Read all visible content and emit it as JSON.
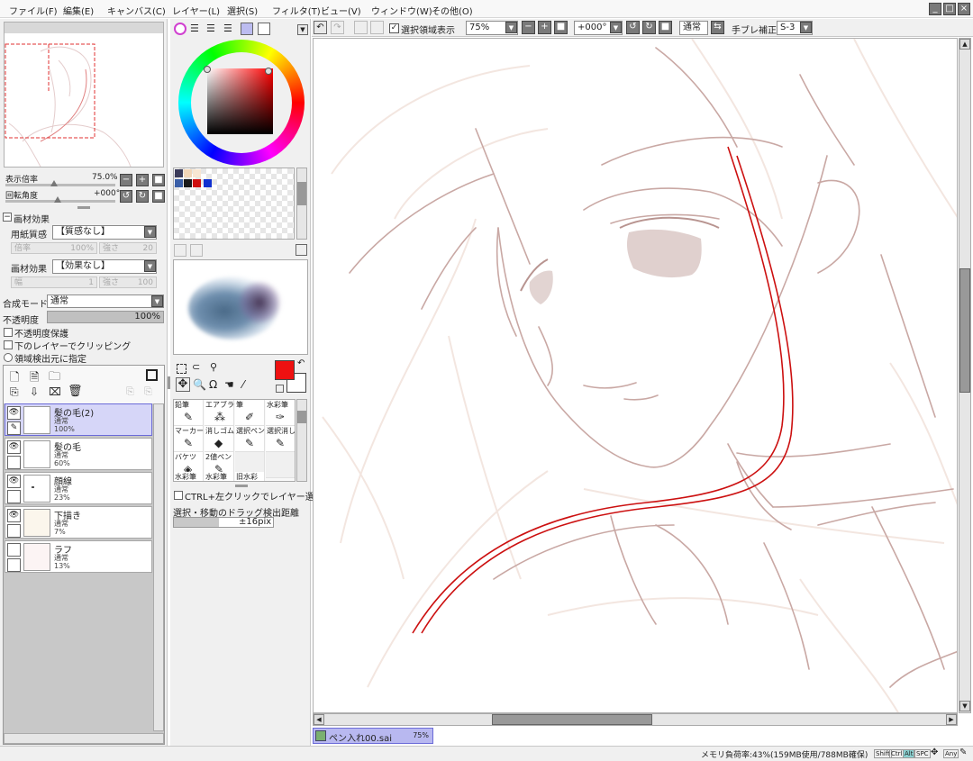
{
  "menu": [
    "ファイル(F)",
    "編集(E)",
    "キャンバス(C)",
    "レイヤー(L)",
    "選択(S)",
    "フィルタ(T)",
    "ビュー(V)",
    "ウィンドウ(W)",
    "その他(O)"
  ],
  "toolbar": {
    "show_selection_label": "選択領域表示",
    "zoom_value": "75%",
    "rotation_value": "+000°",
    "blend_mode": "通常",
    "stabilizer_label": "手ブレ補正",
    "stabilizer_value": "S-3"
  },
  "navigator": {
    "zoom_label": "表示倍率",
    "zoom_value": "75.0%",
    "rotation_label": "回転角度",
    "rotation_value": "+000°"
  },
  "effects": {
    "header": "画材効果",
    "paper_label": "用紙質感",
    "paper_value": "【質感なし】",
    "paper_sub_1": "倍率",
    "paper_sub_1_value": "100%",
    "paper_sub_2": "強さ",
    "paper_sub_2_value": "20",
    "effect_label": "画材効果",
    "effect_value": "【効果なし】",
    "effect_sub_1": "幅",
    "effect_sub_1_value": "1",
    "effect_sub_2": "強さ",
    "effect_sub_2_value": "100"
  },
  "layer_props": {
    "blend_label": "合成モード",
    "blend_value": "通常",
    "opacity_label": "不透明度",
    "opacity_value": "100%",
    "opacity_percent": 100,
    "lock_label": "不透明度保護",
    "clip_label": "下のレイヤーでクリッピング",
    "detect_label": "領域検出元に指定"
  },
  "layers": [
    {
      "name": "髪の毛(2)",
      "mode": "通常",
      "opacity": "100%",
      "selected": true
    },
    {
      "name": "髪の毛",
      "mode": "通常",
      "opacity": "60%",
      "selected": false
    },
    {
      "name": "顔線",
      "mode": "通常",
      "opacity": "23%",
      "selected": false
    },
    {
      "name": "下描き",
      "mode": "通常",
      "opacity": "7%",
      "selected": false
    },
    {
      "name": "ラフ",
      "mode": "通常",
      "opacity": "13%",
      "selected": false
    }
  ],
  "tools": [
    {
      "label": "鉛筆",
      "icon": "✎"
    },
    {
      "label": "エアブラシ",
      "icon": "⁂"
    },
    {
      "label": "筆",
      "icon": "✐"
    },
    {
      "label": "水彩筆",
      "icon": "✑"
    },
    {
      "label": "マーカー",
      "icon": "✎"
    },
    {
      "label": "消しゴム",
      "icon": "◆"
    },
    {
      "label": "選択ペン",
      "icon": "✎"
    },
    {
      "label": "選択消し",
      "icon": "✎"
    },
    {
      "label": "バケツ",
      "icon": "◈"
    },
    {
      "label": "2値ペン",
      "icon": "✎"
    },
    {
      "label": "",
      "icon": ""
    },
    {
      "label": "",
      "icon": ""
    },
    {
      "label": "水彩筆",
      "icon": ""
    },
    {
      "label": "水彩筆",
      "icon": ""
    },
    {
      "label": "旧水彩",
      "icon": ""
    },
    {
      "label": "",
      "icon": ""
    }
  ],
  "options": {
    "ctrl_click_label": "CTRL+左クリックでレイヤー選択",
    "drag_distance_label": "選択・移動のドラッグ検出距離",
    "drag_distance_value": "±16pix",
    "drag_distance_fraction": 0.45
  },
  "document_tab": {
    "filename": "ペン入れ00.sai",
    "zoom": "75%"
  },
  "status_bar": {
    "memory": "メモリ負荷率:43%(159MB使用/788MB確保)",
    "keys": [
      "Shift",
      "Ctrl",
      "Alt",
      "SPC",
      "Any"
    ]
  },
  "colors": {
    "primary": "#ee1111",
    "secondary": "#ffffff",
    "swatches": [
      "#3b3b5a",
      "#f2d6b8",
      "#f8e6d2",
      "#3a5fa8",
      "#1a1a1a",
      "#d01010",
      "#1030d0"
    ],
    "accent": "#8a8ad8",
    "line_red": "#cc1010"
  }
}
